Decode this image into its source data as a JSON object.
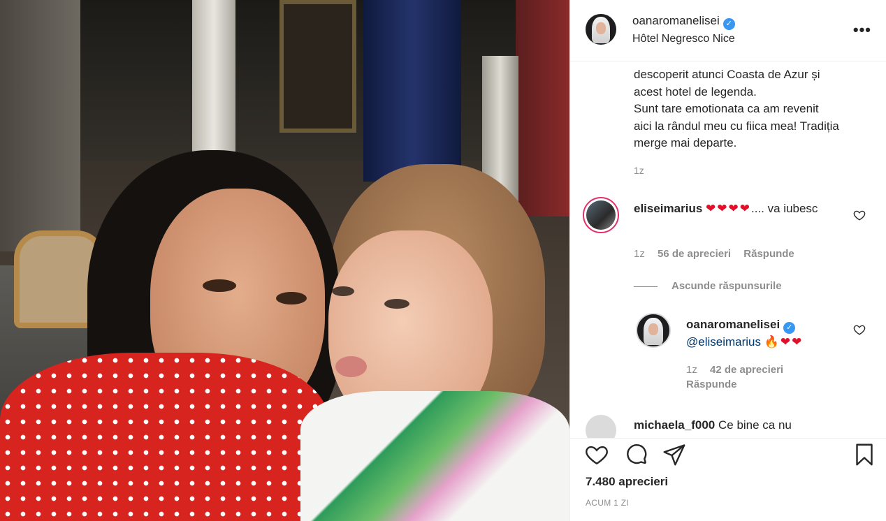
{
  "post": {
    "author": "oanaromanelisei",
    "location": "Hôtel Negresco Nice",
    "more_icon": "more-dots-icon",
    "caption": "descoperit atunci Coasta de Azur și\nacest hotel de legenda.\nSunt tare emotionata ca am revenit\naici la rândul meu cu fiica mea! Tradiția\nmerge mai departe.",
    "caption_time": "1z"
  },
  "comments": [
    {
      "user": "eliseimarius",
      "text_after": ".... va iubesc",
      "emojis": "❤❤❤❤",
      "time": "1z",
      "likes": "56 de aprecieri",
      "reply_label": "Răspunde"
    }
  ],
  "hide_replies_label": "Ascunde răspunsurile",
  "reply": {
    "user": "oanaromanelisei",
    "mention": "@eliseimarius",
    "emojis": "🔥❤❤",
    "time": "1z",
    "likes": "42 de aprecieri",
    "reply_label": "Răspunde"
  },
  "partial_comment": {
    "user": "michaela_f000",
    "text": "Ce bine ca nu"
  },
  "actions": {
    "likes_count": "7.480 aprecieri",
    "post_age": "ACUM 1 ZI"
  },
  "colors": {
    "verified": "#3897f0",
    "story_ring": "#e1306c",
    "mention": "#00376b",
    "heart_emoji": "#e0102a"
  }
}
